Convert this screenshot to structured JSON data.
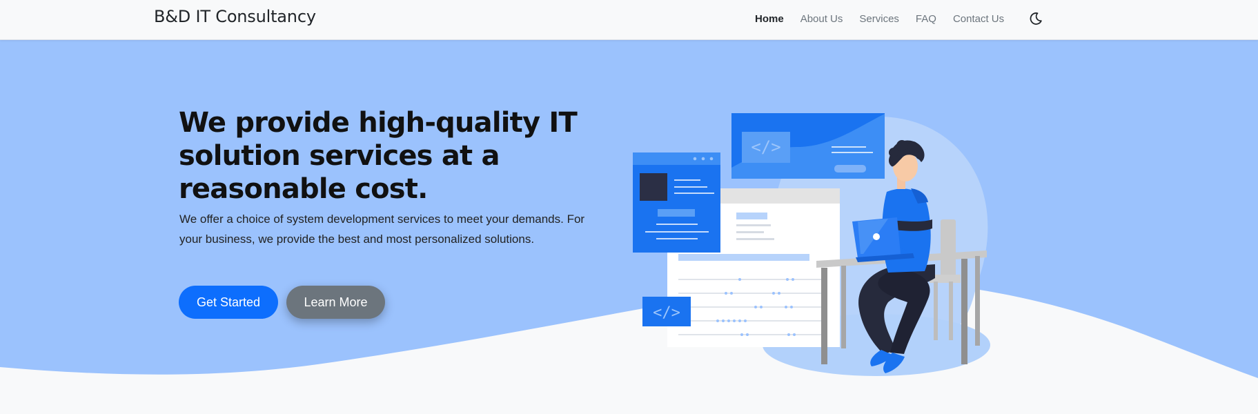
{
  "navbar": {
    "brand": "B&D IT Consultancy",
    "links": [
      {
        "label": "Home",
        "active": true
      },
      {
        "label": "About Us",
        "active": false
      },
      {
        "label": "Services",
        "active": false
      },
      {
        "label": "FAQ",
        "active": false
      },
      {
        "label": "Contact Us",
        "active": false
      }
    ],
    "theme_toggle_icon": "moon-icon"
  },
  "hero": {
    "title": "We provide high-quality IT solution services at a reasonable cost.",
    "description": "We offer a choice of system development services to meet your demands. For your business, we provide the best and most personalized solutions.",
    "primary_button": "Get Started",
    "secondary_button": "Learn More"
  },
  "illustration": {
    "subject": "developer-working-on-laptop",
    "code_icon_text": "</>"
  },
  "colors": {
    "hero_background": "#9bc2fd",
    "primary": "#0d6efd",
    "secondary": "#6c757d",
    "page_background": "#f8f9fa"
  }
}
